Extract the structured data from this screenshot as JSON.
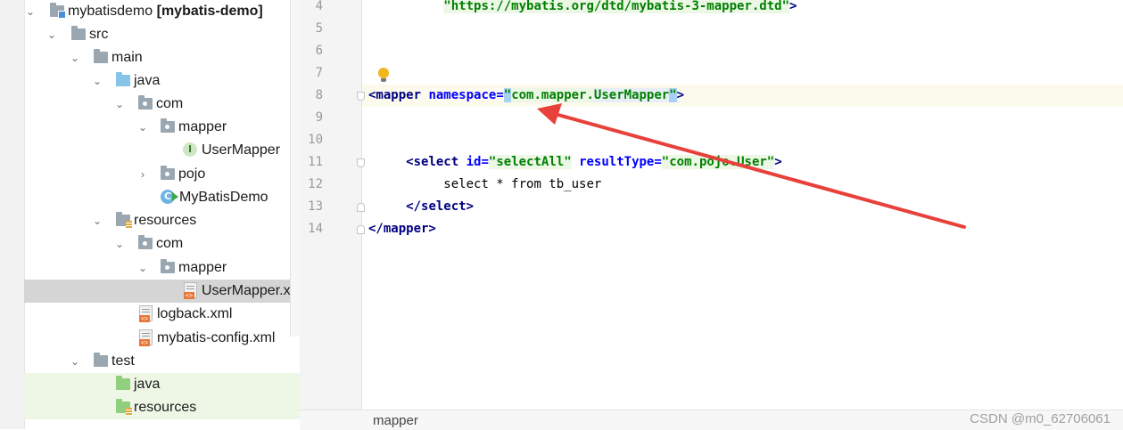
{
  "project_tree": {
    "items": [
      {
        "arrow": "down",
        "icon": "module-folder-icon",
        "label": "mybatisdemo",
        "suffix": "[mybatis-demo]"
      },
      {
        "arrow": "down",
        "icon": "folder-icon",
        "label": "src"
      },
      {
        "arrow": "down",
        "icon": "folder-icon",
        "label": "main"
      },
      {
        "arrow": "down",
        "icon": "source-folder-icon",
        "label": "java"
      },
      {
        "arrow": "down",
        "icon": "package-icon",
        "label": "com"
      },
      {
        "arrow": "down",
        "icon": "package-icon",
        "label": "mapper"
      },
      {
        "arrow": "",
        "icon": "interface-icon",
        "label": "UserMapper"
      },
      {
        "arrow": "right",
        "icon": "package-icon",
        "label": "pojo"
      },
      {
        "arrow": "",
        "icon": "class-icon",
        "label": "MyBatisDemo"
      },
      {
        "arrow": "down",
        "icon": "resources-folder-icon",
        "label": "resources"
      },
      {
        "arrow": "down",
        "icon": "package-icon",
        "label": "com"
      },
      {
        "arrow": "down",
        "icon": "package-icon",
        "label": "mapper"
      },
      {
        "arrow": "",
        "icon": "xml-file-icon",
        "label": "UserMapper.xml"
      },
      {
        "arrow": "",
        "icon": "xml-file-icon",
        "label": "logback.xml"
      },
      {
        "arrow": "",
        "icon": "xml-file-icon",
        "label": "mybatis-config.xml"
      },
      {
        "arrow": "down",
        "icon": "folder-icon",
        "label": "test"
      },
      {
        "arrow": "",
        "icon": "test-source-folder-icon",
        "label": "java"
      },
      {
        "arrow": "",
        "icon": "test-resources-folder-icon",
        "label": "resources"
      }
    ]
  },
  "editor": {
    "line_numbers": [
      "4",
      "5",
      "6",
      "7",
      "8",
      "9",
      "10",
      "11",
      "12",
      "13",
      "14"
    ],
    "lines": {
      "l4": {
        "doctype_uri": "\"https://mybatis.org/dtd/mybatis-3-mapper.dtd\"",
        "close": ">"
      },
      "l8": {
        "open": "<mapper",
        "attr": "namespace",
        "eq": "=",
        "q1": "\"",
        "value_a": "com.mapper.",
        "value_b": "UserMapper",
        "q2": "\"",
        "close": ">"
      },
      "l11": {
        "open": "<select",
        "attr1": "id",
        "eq1": "=",
        "val1": "\"selectAll\"",
        "attr2": "resultType",
        "eq2": "=",
        "val2": "\"com.pojo.User\"",
        "close": ">"
      },
      "l12": {
        "text": "select * from tb_user"
      },
      "l13": {
        "text": "</select>"
      },
      "l14": {
        "text": "</mapper>"
      }
    }
  },
  "breadcrumb": {
    "text": "mapper"
  },
  "watermark": {
    "text": "CSDN @m0_62706061"
  },
  "colors": {
    "annotation_arrow": "#e8403a",
    "tag": "#000080",
    "attribute": "#0000ff",
    "string": "#008000"
  }
}
